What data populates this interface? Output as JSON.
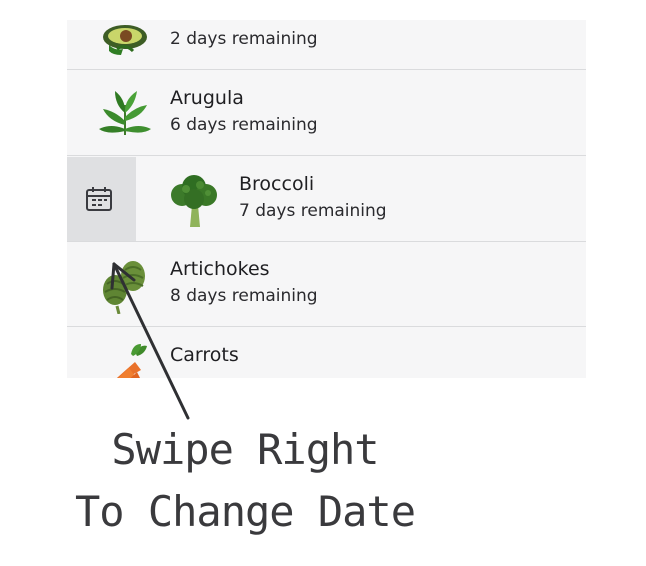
{
  "items": [
    {
      "name": "",
      "days": "2 days remaining",
      "icon": "avocado-icon"
    },
    {
      "name": "Arugula",
      "days": "6 days remaining",
      "icon": "arugula-icon"
    },
    {
      "name": "Broccoli",
      "days": "7 days remaining",
      "icon": "broccoli-icon"
    },
    {
      "name": "Artichokes",
      "days": "8 days remaining",
      "icon": "artichoke-icon"
    },
    {
      "name": "Carrots",
      "days": "",
      "icon": "carrot-icon"
    }
  ],
  "swipe_action": {
    "icon": "calendar-icon",
    "row": "Broccoli"
  },
  "annotation": {
    "line1": "Swipe Right",
    "line2": "To Change Date"
  },
  "colors": {
    "row_background": "#f6f6f7",
    "action_background": "#dfe0e2",
    "divider": "#dadbdd",
    "text": "#1f1f22",
    "annotation_ink": "#3a3a3d"
  }
}
